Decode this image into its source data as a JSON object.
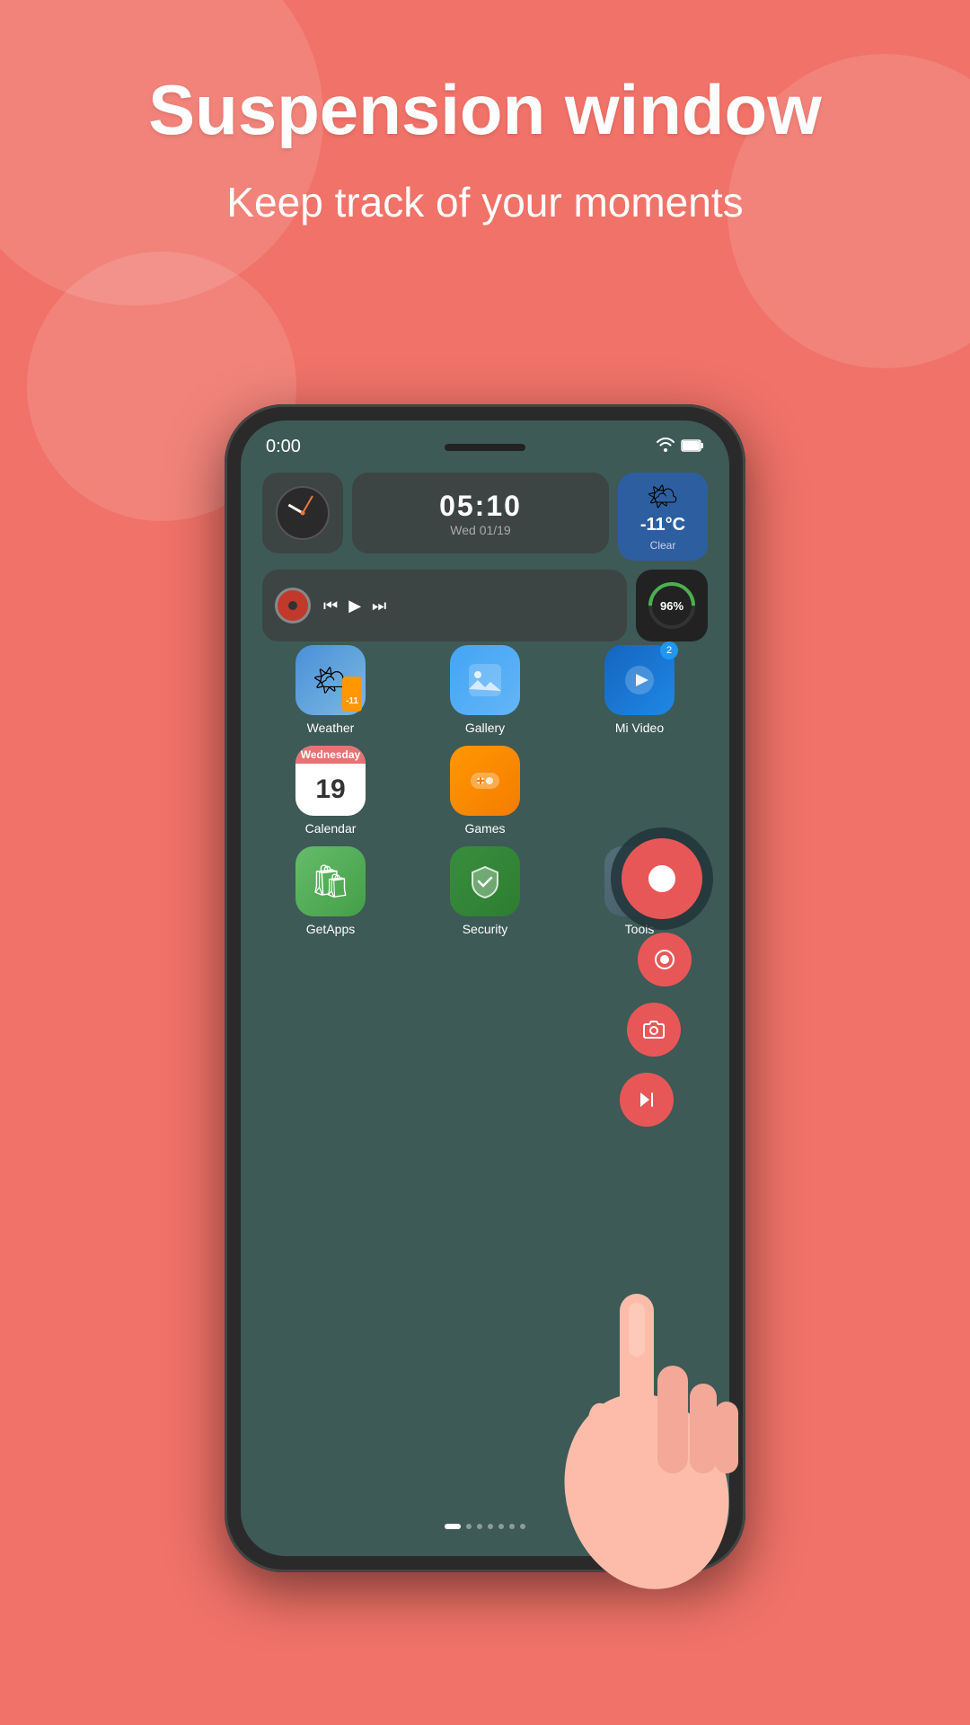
{
  "header": {
    "title": "Suspension window",
    "subtitle": "Keep track of your moments"
  },
  "phone": {
    "status_bar": {
      "time": "0:00",
      "wifi": "📶",
      "battery": "96"
    },
    "clock_widget": {
      "time": "05:10",
      "day": "Wed",
      "date": "01/19"
    },
    "weather_widget": {
      "temp": "-11°C",
      "desc": "Clear"
    },
    "battery_widget": {
      "percent": "96%"
    },
    "apps": [
      {
        "name": "Weather",
        "type": "weather"
      },
      {
        "name": "Gallery",
        "type": "gallery"
      },
      {
        "name": "Mi Video",
        "type": "mivideo",
        "badge": "2"
      },
      {
        "name": "Calendar",
        "type": "calendar",
        "day_name": "Wednesday",
        "day_num": "19"
      },
      {
        "name": "Games",
        "type": "games"
      },
      {
        "name": "",
        "type": "empty"
      },
      {
        "name": "GetApps",
        "type": "getapps"
      },
      {
        "name": "Security",
        "type": "security"
      },
      {
        "name": "Tools",
        "type": "tools"
      }
    ]
  },
  "colors": {
    "background": "#F07268",
    "phone_screen": "#3d5a56",
    "floating_button": "#e85757",
    "weather_widget": "#2d5fa0"
  }
}
